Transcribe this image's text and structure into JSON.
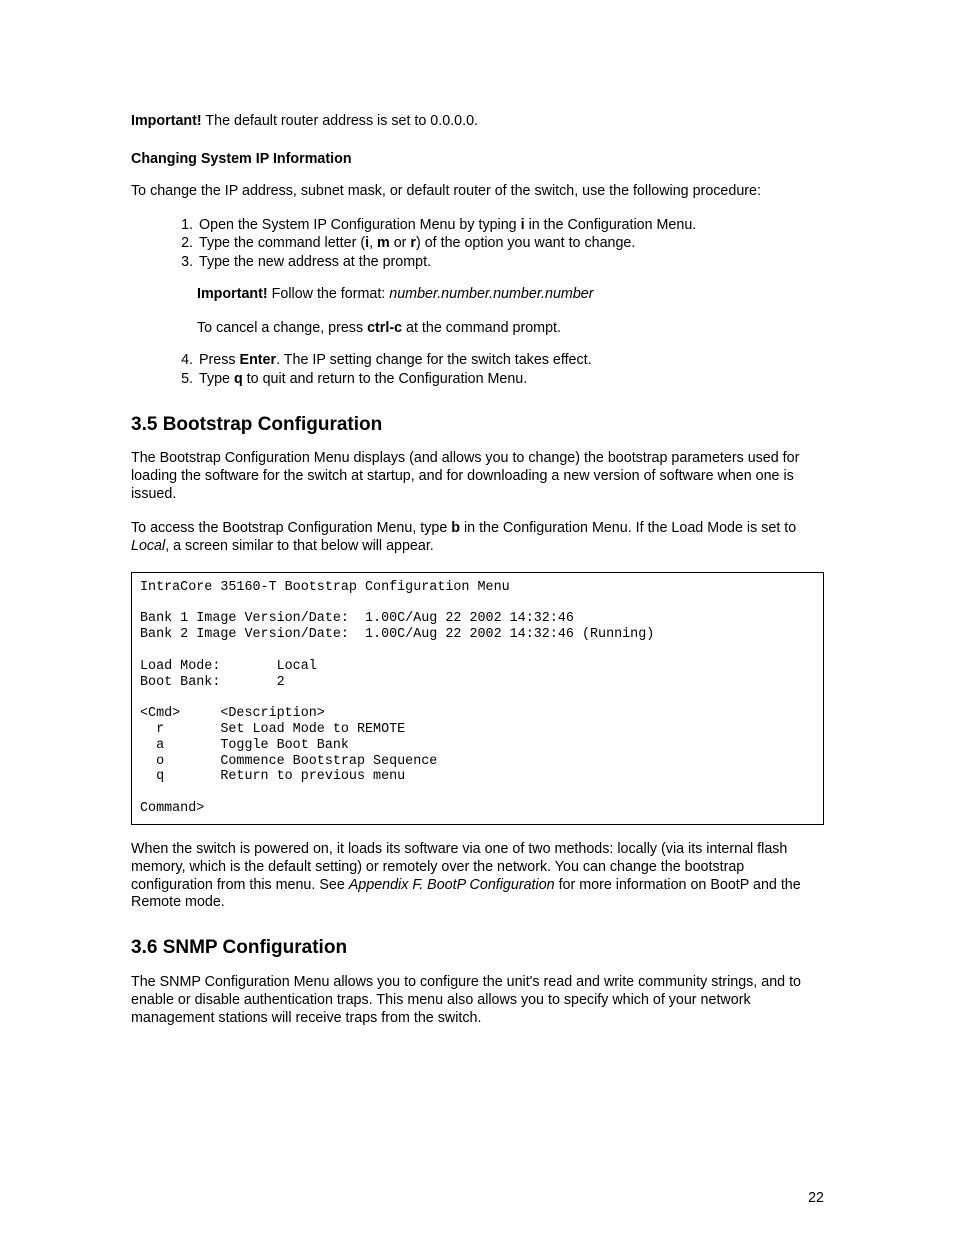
{
  "intro": {
    "important_label": "Important!",
    "important_text": " The default router address is set to 0.0.0.0."
  },
  "changing_ip": {
    "heading": "Changing System IP Information",
    "intro": "To change the IP address, subnet mask, or default router of the switch, use the following procedure:",
    "step1_a": "Open the System IP Configuration Menu by typing ",
    "step1_b": "i",
    "step1_c": " in the Configuration Menu.",
    "step2_a": "Type the command letter (",
    "step2_i": "i",
    "step2_comma": ", ",
    "step2_m": "m",
    "step2_or": " or ",
    "step2_r": "r",
    "step2_b": ") of the option you want to change.",
    "step3": "Type the new address at the prompt.",
    "note_label": "Important!",
    "note_a": " Follow the format: ",
    "note_format": "number.number.number.number",
    "cancel_a": "To cancel a change, press ",
    "cancel_key": "ctrl-c",
    "cancel_b": " at the command prompt.",
    "step4_a": "Press ",
    "step4_key": "Enter",
    "step4_b": ". The IP setting change for the switch takes effect.",
    "step5_a": "Type ",
    "step5_key": "q",
    "step5_b": " to quit and return to the Configuration Menu."
  },
  "section35": {
    "heading": "3.5 Bootstrap Configuration",
    "para1": "The Bootstrap Configuration Menu displays (and allows you to change) the bootstrap parameters used for loading the software for the switch at startup, and for downloading a new version of software when one is issued.",
    "para2_a": "To access the Bootstrap Configuration Menu, type ",
    "para2_key": "b",
    "para2_b": " in the Configuration Menu. If the Load Mode is set to ",
    "para2_local": "Local",
    "para2_c": ", a screen similar to that below will appear.",
    "code": "IntraCore 35160-T Bootstrap Configuration Menu\n\nBank 1 Image Version/Date:  1.00C/Aug 22 2002 14:32:46\nBank 2 Image Version/Date:  1.00C/Aug 22 2002 14:32:46 (Running)\n\nLoad Mode:       Local\nBoot Bank:       2\n\n<Cmd>     <Description>\n  r       Set Load Mode to REMOTE\n  a       Toggle Boot Bank\n  o       Commence Bootstrap Sequence\n  q       Return to previous menu\n\nCommand>",
    "para3_a": "When the switch is powered on, it loads its software via one of two methods: locally (via its internal flash memory, which is the default setting) or remotely over the network. You can change the bootstrap configuration from this menu. See ",
    "para3_ref": "Appendix F. BootP Configuration",
    "para3_b": " for more information on BootP and the Remote mode."
  },
  "section36": {
    "heading": "3.6 SNMP Configuration",
    "para1": "The SNMP Configuration Menu allows you to configure the unit's read and write community strings, and to enable or disable authentication traps. This menu also allows you to specify which of your network management stations will receive traps from the switch."
  },
  "page_number": "22"
}
